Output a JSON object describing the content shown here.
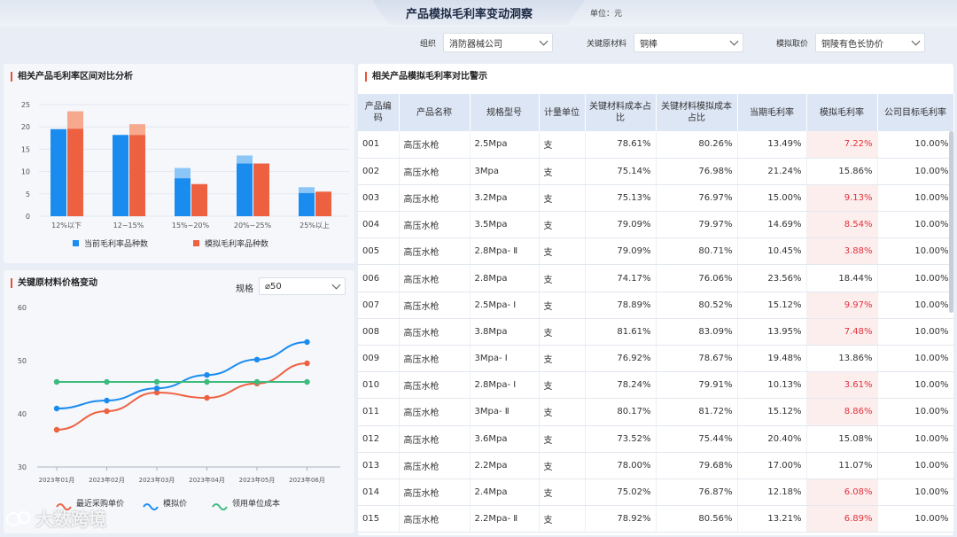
{
  "header": {
    "title": "产品模拟毛利率变动洞察",
    "unit": "单位：元"
  },
  "filters": {
    "org": {
      "label": "组织",
      "value": "消防器械公司"
    },
    "material": {
      "label": "关键原材料",
      "value": "铜棒"
    },
    "price": {
      "label": "模拟取价",
      "value": "铜陵有色长协价"
    }
  },
  "bar_panel": {
    "title": "相关产品毛利率区间对比分析"
  },
  "line_panel": {
    "title": "关键原材料价格变动",
    "spec_label": "规格",
    "spec_value": "⌀50"
  },
  "table_panel": {
    "title": "相关产品模拟毛利率对比警示"
  },
  "table": {
    "headers": [
      "产品编码",
      "产品名称",
      "规格型号",
      "计量单位",
      "关键材料成本占比",
      "关键材料模拟成本占比",
      "当期毛利率",
      "模拟毛利率",
      "公司目标毛利率"
    ],
    "rows": [
      [
        "001",
        "高压水枪",
        "2.5Mpa",
        "支",
        "78.61%",
        "80.26%",
        "13.49%",
        "7.22%",
        "10.00%"
      ],
      [
        "002",
        "高压水枪",
        "3Mpa",
        "支",
        "75.14%",
        "76.98%",
        "21.24%",
        "15.86%",
        "10.00%"
      ],
      [
        "003",
        "高压水枪",
        "3.2Mpa",
        "支",
        "75.13%",
        "76.97%",
        "15.00%",
        "9.13%",
        "10.00%"
      ],
      [
        "004",
        "高压水枪",
        "3.5Mpa",
        "支",
        "79.09%",
        "79.97%",
        "14.69%",
        "8.54%",
        "10.00%"
      ],
      [
        "005",
        "高压水枪",
        "2.8Mpa- Ⅱ",
        "支",
        "79.09%",
        "80.71%",
        "10.45%",
        "3.88%",
        "10.00%"
      ],
      [
        "006",
        "高压水枪",
        "2.8Mpa",
        "支",
        "74.17%",
        "76.06%",
        "23.56%",
        "18.44%",
        "10.00%"
      ],
      [
        "007",
        "高压水枪",
        "2.5Mpa- Ⅰ",
        "支",
        "78.89%",
        "80.52%",
        "15.12%",
        "9.97%",
        "10.00%"
      ],
      [
        "008",
        "高压水枪",
        "3.8Mpa",
        "支",
        "81.61%",
        "83.09%",
        "13.95%",
        "7.48%",
        "10.00%"
      ],
      [
        "009",
        "高压水枪",
        "3Mpa- Ⅰ",
        "支",
        "76.92%",
        "78.67%",
        "19.48%",
        "13.86%",
        "10.00%"
      ],
      [
        "010",
        "高压水枪",
        "2.8Mpa- Ⅰ",
        "支",
        "78.24%",
        "79.91%",
        "10.13%",
        "3.61%",
        "10.00%"
      ],
      [
        "011",
        "高压水枪",
        "3Mpa- Ⅱ",
        "支",
        "80.17%",
        "81.72%",
        "15.12%",
        "8.86%",
        "10.00%"
      ],
      [
        "012",
        "高压水枪",
        "3.6Mpa",
        "支",
        "73.52%",
        "75.44%",
        "20.40%",
        "15.08%",
        "10.00%"
      ],
      [
        "013",
        "高压水枪",
        "2.2Mpa",
        "支",
        "78.00%",
        "79.68%",
        "17.00%",
        "11.07%",
        "10.00%"
      ],
      [
        "014",
        "高压水枪",
        "2.4Mpa",
        "支",
        "75.02%",
        "76.87%",
        "12.18%",
        "6.08%",
        "10.00%"
      ],
      [
        "015",
        "高压水枪",
        "2.2Mpa- Ⅱ",
        "支",
        "78.92%",
        "80.56%",
        "13.21%",
        "6.89%",
        "10.00%"
      ]
    ]
  },
  "watermark": "大数跨境",
  "colors": {
    "blue": "#1a8cf0",
    "orange": "#ee6140",
    "green": "#3dbb7d",
    "warn": "#e0323c"
  },
  "chart_data": [
    {
      "type": "bar",
      "categories": [
        "12%以下",
        "12~15%",
        "15%~20%",
        "20%~25%",
        "25%以上"
      ],
      "series": [
        {
          "name": "当前毛利率品种数",
          "values": [
            19.5,
            18.2,
            8.5,
            11.8,
            5.2
          ],
          "simulated_overlay": [
            19.5,
            18.2,
            10.8,
            13.6,
            6.5
          ]
        },
        {
          "name": "模拟毛利率品种数",
          "values": [
            19.6,
            18.2,
            7.2,
            11.8,
            5.5
          ],
          "simulated_overlay": [
            23.5,
            20.6,
            7.2,
            11.8,
            5.5
          ]
        }
      ],
      "yticks": [
        0,
        5,
        10,
        15,
        20,
        25
      ],
      "ylim": [
        0,
        25
      ],
      "legend": "bottom"
    },
    {
      "type": "line",
      "x": [
        "2023年01月",
        "2023年02月",
        "2023年03月",
        "2023年04月",
        "2023年05月",
        "2023年06月"
      ],
      "series": [
        {
          "name": "最近采购单价",
          "values": [
            37,
            40.5,
            44,
            43,
            45.7,
            49.5
          ],
          "smooth": true
        },
        {
          "name": "模拟价",
          "values": [
            41,
            42.5,
            44.8,
            47.3,
            50.2,
            53.5
          ],
          "smooth": true
        },
        {
          "name": "领用单位成本",
          "values": [
            46,
            46,
            46,
            46,
            46,
            46
          ],
          "smooth": false
        }
      ],
      "yticks": [
        30,
        40,
        50,
        60
      ],
      "ylim": [
        30,
        60
      ],
      "legend": "bottom"
    }
  ]
}
